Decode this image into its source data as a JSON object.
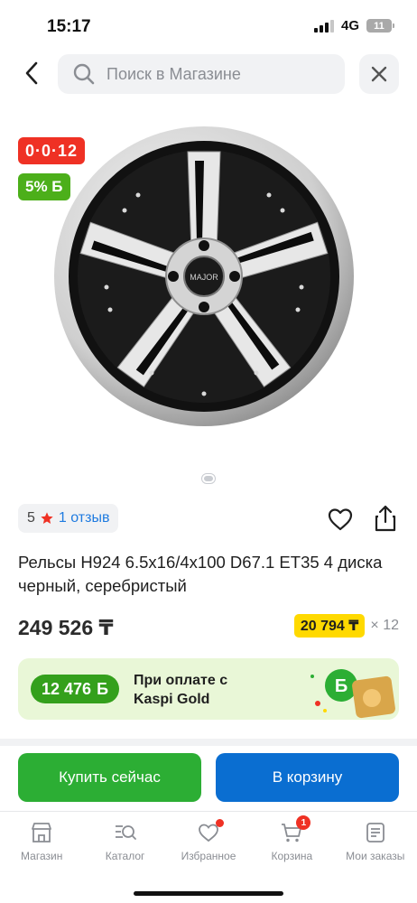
{
  "status_bar": {
    "time": "15:17",
    "network": "4G",
    "battery": "11"
  },
  "search": {
    "placeholder": "Поиск в Магазине"
  },
  "badges": {
    "installment": "0·0·12",
    "bonus": "5% Б"
  },
  "product": {
    "rating": "5",
    "reviews": "1 отзыв",
    "title": "Рельсы H924 6.5x16/4x100 D67.1 ET35 4 диска черный, серебристый",
    "price": "249 526 ₸",
    "monthly_amount": "20 794 ₸",
    "monthly_multiplier": "× 12",
    "wheel_brand_cap": "MAJOR"
  },
  "kaspi_gold": {
    "bonus_amount": "12 476",
    "bonus_symbol": "Б",
    "text_line1": "При оплате с",
    "text_line2": "Kaspi Gold"
  },
  "actions": {
    "buy_now": "Купить сейчас",
    "add_to_cart": "В корзину"
  },
  "tabbar": [
    {
      "label": "Магазин",
      "icon": "store-icon"
    },
    {
      "label": "Каталог",
      "icon": "catalog-search-icon"
    },
    {
      "label": "Избранное",
      "icon": "heart-icon"
    },
    {
      "label": "Корзина",
      "icon": "cart-icon",
      "badge": "1"
    },
    {
      "label": "Мои заказы",
      "icon": "orders-icon"
    }
  ],
  "colors": {
    "accent_red": "#ef3124",
    "kaspi_green": "#2cae34",
    "kaspi_blue": "#0a6ed1",
    "installment_yellow": "#ffd900"
  }
}
